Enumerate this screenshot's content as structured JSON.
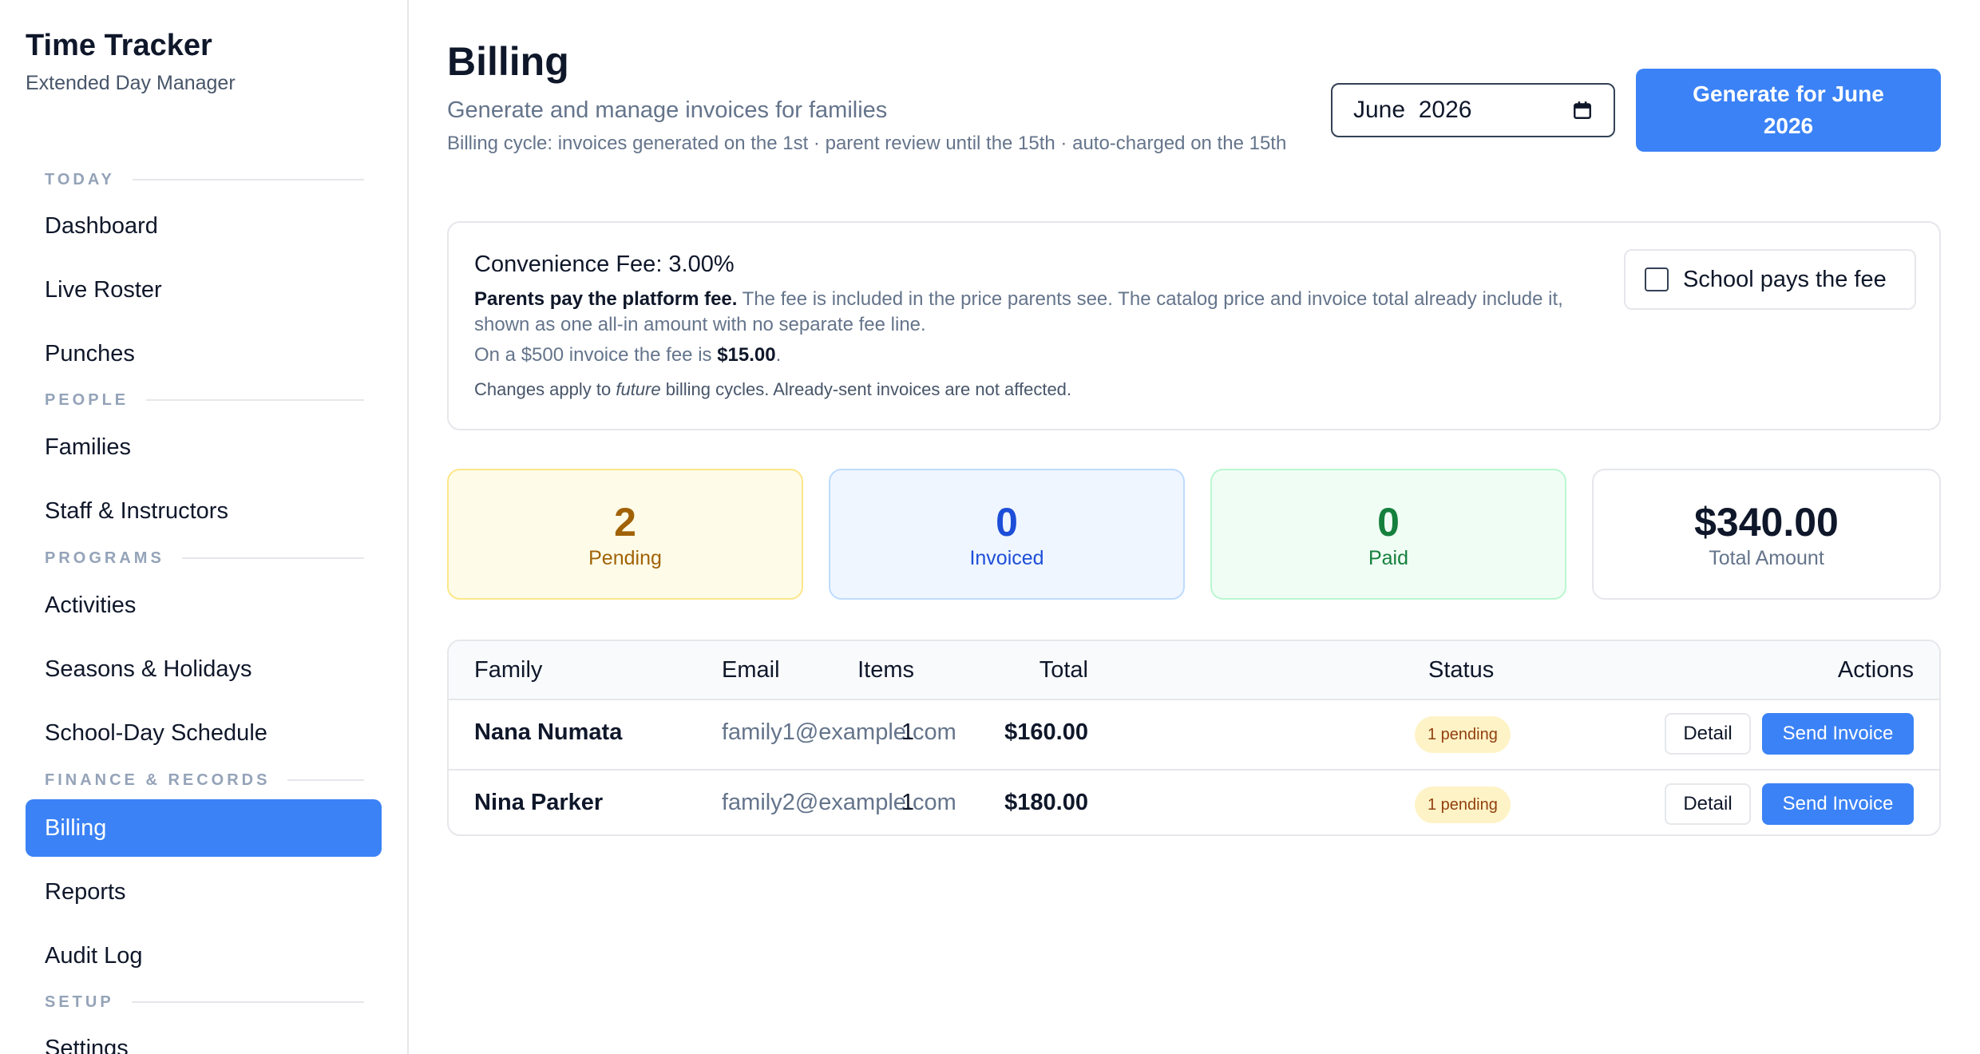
{
  "sidebar": {
    "brand_title": "Time Tracker",
    "brand_subtitle": "Extended Day Manager",
    "sections": [
      {
        "title": "TODAY",
        "items": [
          "Dashboard",
          "Live Roster",
          "Punches"
        ]
      },
      {
        "title": "PEOPLE",
        "items": [
          "Families",
          "Staff & Instructors"
        ]
      },
      {
        "title": "PROGRAMS",
        "items": [
          "Activities",
          "Seasons & Holidays",
          "School-Day Schedule"
        ]
      },
      {
        "title": "FINANCE & RECORDS",
        "items": [
          "Billing",
          "Reports",
          "Audit Log"
        ]
      },
      {
        "title": "SETUP",
        "items": [
          "Settings"
        ]
      }
    ],
    "active_item": "Billing"
  },
  "header": {
    "title": "Billing",
    "subtitle": "Generate and manage invoices for families",
    "cycle_note": "Billing cycle: invoices generated on the 1st · parent review until the 15th · auto-charged on the 15th",
    "month_value": "June  2026",
    "generate_label": "Generate for June 2026"
  },
  "fee": {
    "title": "Convenience Fee: 3.00%",
    "desc_bold": "Parents pay the platform fee.",
    "desc_rest": " The fee is included in the price parents see. The catalog price and invoice total already include it, shown as one all-in amount with no separate fee line.",
    "example_prefix": "On a $500 invoice the fee is ",
    "example_value": "$15.00",
    "example_suffix": ".",
    "note_prefix": "Changes apply to ",
    "note_italic": "future",
    "note_suffix": " billing cycles. Already-sent invoices are not affected.",
    "toggle_label": "School pays the fee",
    "toggle_checked": false
  },
  "stats": {
    "pending": {
      "value": "2",
      "label": "Pending"
    },
    "invoiced": {
      "value": "0",
      "label": "Invoiced"
    },
    "paid": {
      "value": "0",
      "label": "Paid"
    },
    "total": {
      "value": "$340.00",
      "label": "Total Amount"
    }
  },
  "table": {
    "headers": {
      "family": "Family",
      "email": "Email",
      "items": "Items",
      "total": "Total",
      "status": "Status",
      "actions": "Actions"
    },
    "rows": [
      {
        "family": "Nana Numata",
        "email": "family1@example.com",
        "items": "1",
        "total": "$160.00",
        "status": "1 pending",
        "detail": "Detail",
        "send": "Send Invoice"
      },
      {
        "family": "Nina Parker",
        "email": "family2@example.com",
        "items": "1",
        "total": "$180.00",
        "status": "1 pending",
        "detail": "Detail",
        "send": "Send Invoice"
      }
    ]
  },
  "colors": {
    "accent": "#3b82f6",
    "pending": "#a16207",
    "invoiced": "#1d4ed8",
    "paid": "#15803d"
  }
}
